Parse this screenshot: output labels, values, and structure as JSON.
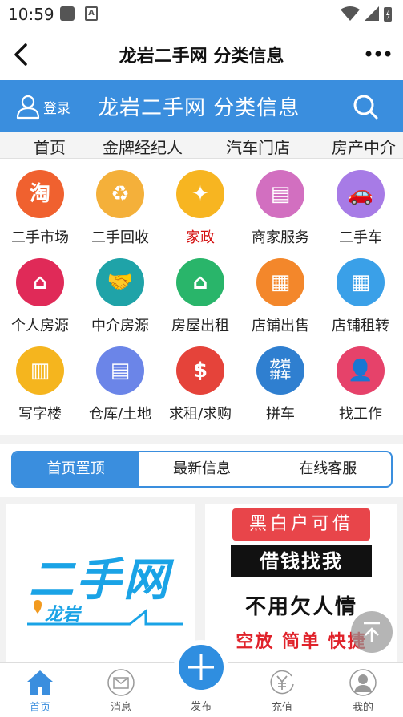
{
  "status_bar": {
    "time": "10:59",
    "notif_a": "A"
  },
  "titlebar": {
    "title": "龙岩二手网 分类信息"
  },
  "header": {
    "login_label": "登录",
    "title": "龙岩二手网 分类信息"
  },
  "nav_tabs": [
    "首页",
    "金牌经纪人",
    "汽车门店",
    "房产中介"
  ],
  "categories": [
    {
      "label": "二手市场",
      "icon": "taobao-icon",
      "color": "#f0612f",
      "glyph": "淘"
    },
    {
      "label": "二手回收",
      "icon": "recycle-icon",
      "color": "#f4b03a",
      "glyph": "♻"
    },
    {
      "label": "家政",
      "icon": "broom-icon",
      "color": "#f7b521",
      "glyph": "✦"
    },
    {
      "label": "商家服务",
      "icon": "document-icon",
      "color": "#d26fc0",
      "glyph": "▤"
    },
    {
      "label": "二手车",
      "icon": "car-icon",
      "color": "#a77be6",
      "glyph": "🚗"
    },
    {
      "label": "个人房源",
      "icon": "family-house-icon",
      "color": "#e02a58",
      "glyph": "⌂"
    },
    {
      "label": "中介房源",
      "icon": "handshake-icon",
      "color": "#1fa3a8",
      "glyph": "🤝"
    },
    {
      "label": "房屋出租",
      "icon": "house-icon",
      "color": "#29b56a",
      "glyph": "⌂"
    },
    {
      "label": "店铺出售",
      "icon": "shop-icon",
      "color": "#f3872b",
      "glyph": "▦"
    },
    {
      "label": "店铺租转",
      "icon": "storefront-icon",
      "color": "#3aa0e8",
      "glyph": "▦"
    },
    {
      "label": "写字楼",
      "icon": "office-building-icon",
      "color": "#f5b51e",
      "glyph": "▥"
    },
    {
      "label": "仓库/土地",
      "icon": "warehouse-icon",
      "color": "#6b85e8",
      "glyph": "▤"
    },
    {
      "label": "求租/求购",
      "icon": "money-house-icon",
      "color": "#e5433a",
      "glyph": "$"
    },
    {
      "label": "拼车",
      "icon": "carpool-icon",
      "color": "#2f7fd0",
      "glyph": "龙岩拼车"
    },
    {
      "label": "找工作",
      "icon": "job-seeker-icon",
      "color": "#e6426a",
      "glyph": "👤"
    }
  ],
  "highlight_category": "家政",
  "segments": {
    "tab1": "首页置顶",
    "tab2": "最新信息",
    "tab3": "在线客服"
  },
  "banner1": {
    "logo": "二手网",
    "sub": "龙岩"
  },
  "banner2": {
    "line1": "黑白户可借",
    "line2": "借钱找我",
    "line3": "不用欠人情",
    "line4": "空放 简单 快捷"
  },
  "bottom_nav": {
    "home": "首页",
    "messages": "消息",
    "publish": "发布",
    "recharge": "充值",
    "mine": "我的"
  },
  "colors": {
    "primary": "#3a8ede",
    "highlight": "#d40f0f"
  }
}
